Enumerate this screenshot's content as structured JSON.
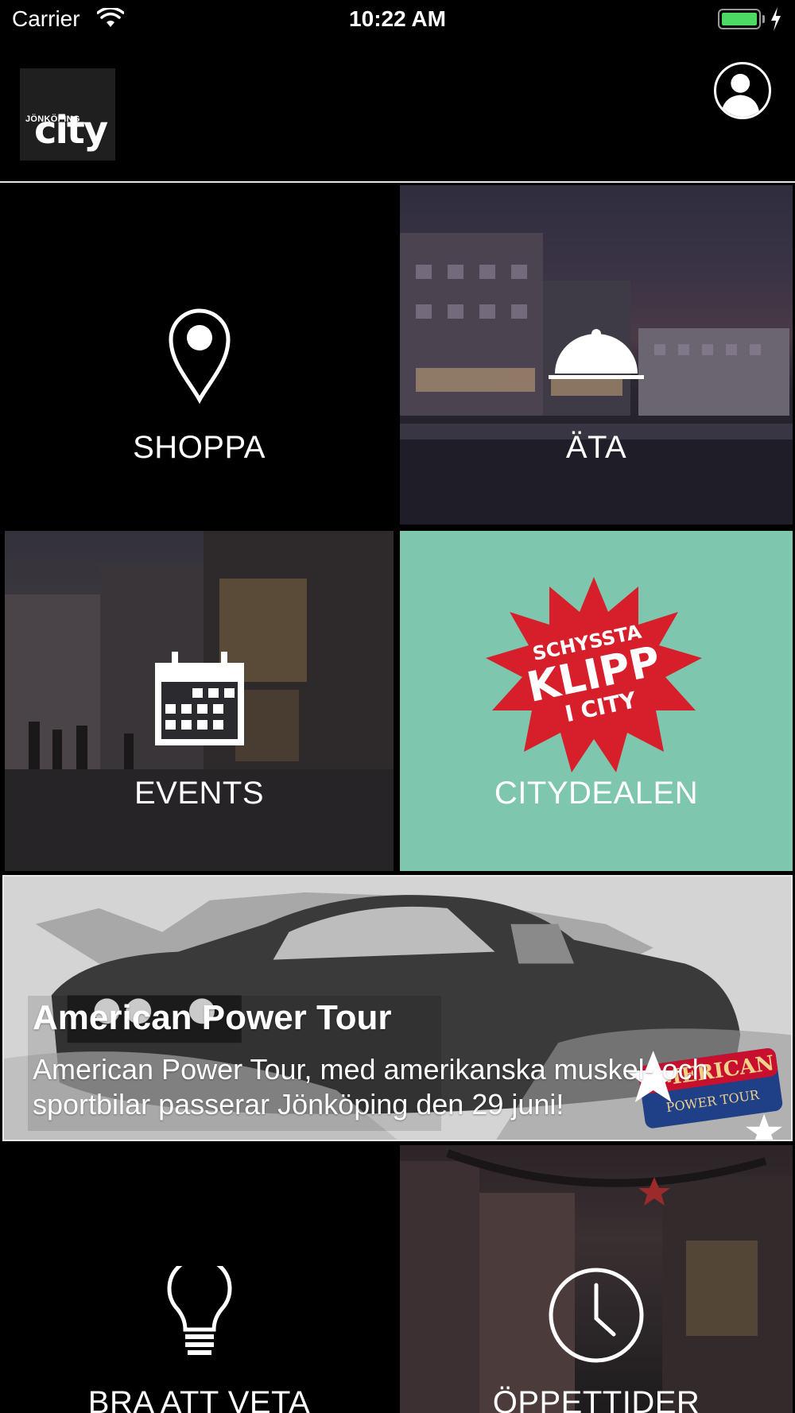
{
  "status_bar": {
    "carrier": "Carrier",
    "time": "10:22 AM",
    "battery_color": "#4cd964"
  },
  "header": {
    "logo": {
      "small_text": "JÖNKÖPING",
      "big_text": "city"
    },
    "profile_icon": "user-avatar-icon"
  },
  "tiles": [
    {
      "id": "shoppa",
      "label": "SHOPPA",
      "icon": "map-pin-icon"
    },
    {
      "id": "ata",
      "label": "ÄTA",
      "icon": "cloche-icon"
    },
    {
      "id": "events",
      "label": "EVENTS",
      "icon": "calendar-icon"
    },
    {
      "id": "citydealen",
      "label": "CITYDEALEN",
      "icon": "starburst-badge",
      "badge_lines": [
        "SCHYSSTA",
        "KLIPP",
        "I CITY"
      ],
      "background": "#7ec7ae"
    },
    {
      "id": "bra_att_veta",
      "label": "BRA ATT VETA",
      "icon": "lightbulb-icon"
    },
    {
      "id": "oppettider",
      "label": "ÖPPETTIDER",
      "icon": "clock-icon"
    }
  ],
  "featured_event": {
    "title": "American Power Tour",
    "description": "American Power Tour, med amerikanska muskel- och sportbilar passerar Jönköping den 29 juni!",
    "badge_text": [
      "AMERICAN",
      "POWER TOUR"
    ]
  }
}
